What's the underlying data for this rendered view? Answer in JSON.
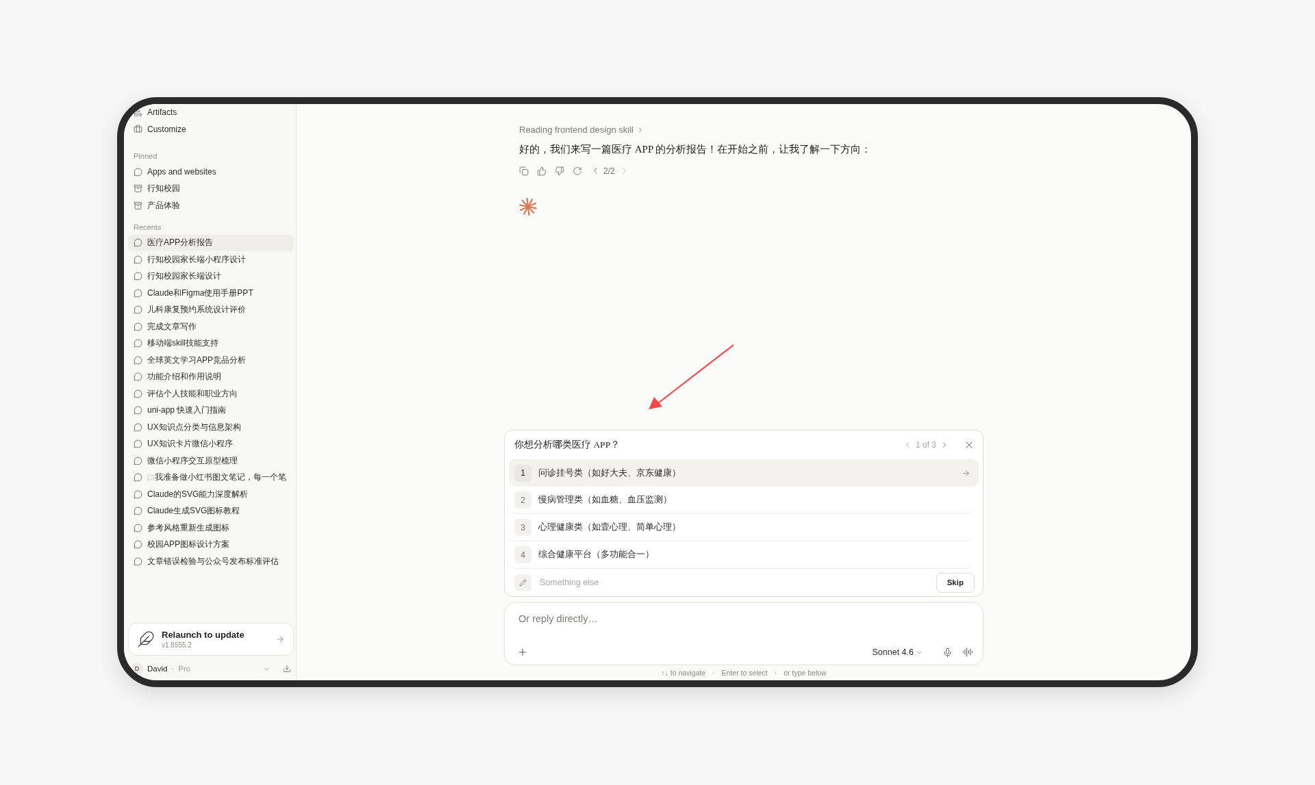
{
  "sidebar": {
    "top_items": [
      {
        "label": "Artifacts",
        "kind": "artifacts"
      },
      {
        "label": "Customize",
        "kind": "customize"
      }
    ],
    "pinned": {
      "heading": "Pinned",
      "items": [
        {
          "label": "Apps and websites",
          "kind": "chat"
        },
        {
          "label": "行知校园",
          "kind": "project"
        },
        {
          "label": "产品体验",
          "kind": "project"
        }
      ]
    },
    "recents": {
      "heading": "Recents",
      "items": [
        {
          "label": "医疗APP分析报告",
          "selected": true,
          "kind": "chat"
        },
        {
          "label": "行知校园家长端小程序设计",
          "selected": false,
          "kind": "chat"
        },
        {
          "label": "行知校园家长端设计",
          "selected": false,
          "kind": "chat"
        },
        {
          "label": "Claude和Figma使用手册PPT",
          "selected": false,
          "kind": "chat"
        },
        {
          "label": "儿科康复预约系统设计评价",
          "selected": false,
          "kind": "chat"
        },
        {
          "label": "完成文章写作",
          "selected": false,
          "kind": "chat"
        },
        {
          "label": "移动端skill技能支持",
          "selected": false,
          "kind": "chat"
        },
        {
          "label": "全球英文学习APP竞品分析",
          "selected": false,
          "kind": "chat"
        },
        {
          "label": "功能介绍和作用说明",
          "selected": false,
          "kind": "chat"
        },
        {
          "label": "评估个人技能和职业方向",
          "selected": false,
          "kind": "chat"
        },
        {
          "label": "uni-app 快速入门指南",
          "selected": false,
          "kind": "chat"
        },
        {
          "label": "UX知识点分类与信息架构",
          "selected": false,
          "kind": "chat"
        },
        {
          "label": "UX知识卡片微信小程序",
          "selected": false,
          "kind": "chat"
        },
        {
          "label": "微信小程序交互原型梳理",
          "selected": false,
          "kind": "chat"
        },
        {
          "label": "我准备做小红书图文笔记，每一个笔",
          "selected": false,
          "kind": "note"
        },
        {
          "label": "Claude的SVG能力深度解析",
          "selected": false,
          "kind": "chat"
        },
        {
          "label": "Claude生成SVG图标教程",
          "selected": false,
          "kind": "chat"
        },
        {
          "label": "参考风格重新生成图标",
          "selected": false,
          "kind": "chat"
        },
        {
          "label": "校园APP图标设计方案",
          "selected": false,
          "kind": "chat"
        },
        {
          "label": "文章错误检验与公众号发布标准评估",
          "selected": false,
          "kind": "chat"
        }
      ]
    },
    "update_card": {
      "title": "Relaunch to update",
      "version": "v1.8555.2"
    },
    "user": {
      "initial": "D",
      "name": "David",
      "separator": "·",
      "plan": "Pro"
    }
  },
  "message": {
    "skill_note": "Reading frontend design skill",
    "text": "好的，我们来写一篇医疗 APP 的分析报告！在开始之前，让我了解一下方向：",
    "pager": "2/2"
  },
  "question": {
    "title": "你想分析哪类医疗 APP？",
    "pager": "1 of 3",
    "options": [
      {
        "number": "1",
        "label": "问诊挂号类（如好大夫、京东健康）",
        "selected": true
      },
      {
        "number": "2",
        "label": "慢病管理类（如血糖、血压监测）",
        "selected": false
      },
      {
        "number": "3",
        "label": "心理健康类（如壹心理、简单心理）",
        "selected": false
      },
      {
        "number": "4",
        "label": "综合健康平台（多功能合一）",
        "selected": false
      }
    ],
    "other": {
      "placeholder": "Something else"
    },
    "skip": "Skip"
  },
  "composer": {
    "placeholder": "Or reply directly…",
    "model": "Sonnet 4.6"
  },
  "hints": {
    "items": [
      "↑↓ to navigate",
      "Enter to select",
      "or type below"
    ],
    "separator": "·"
  }
}
